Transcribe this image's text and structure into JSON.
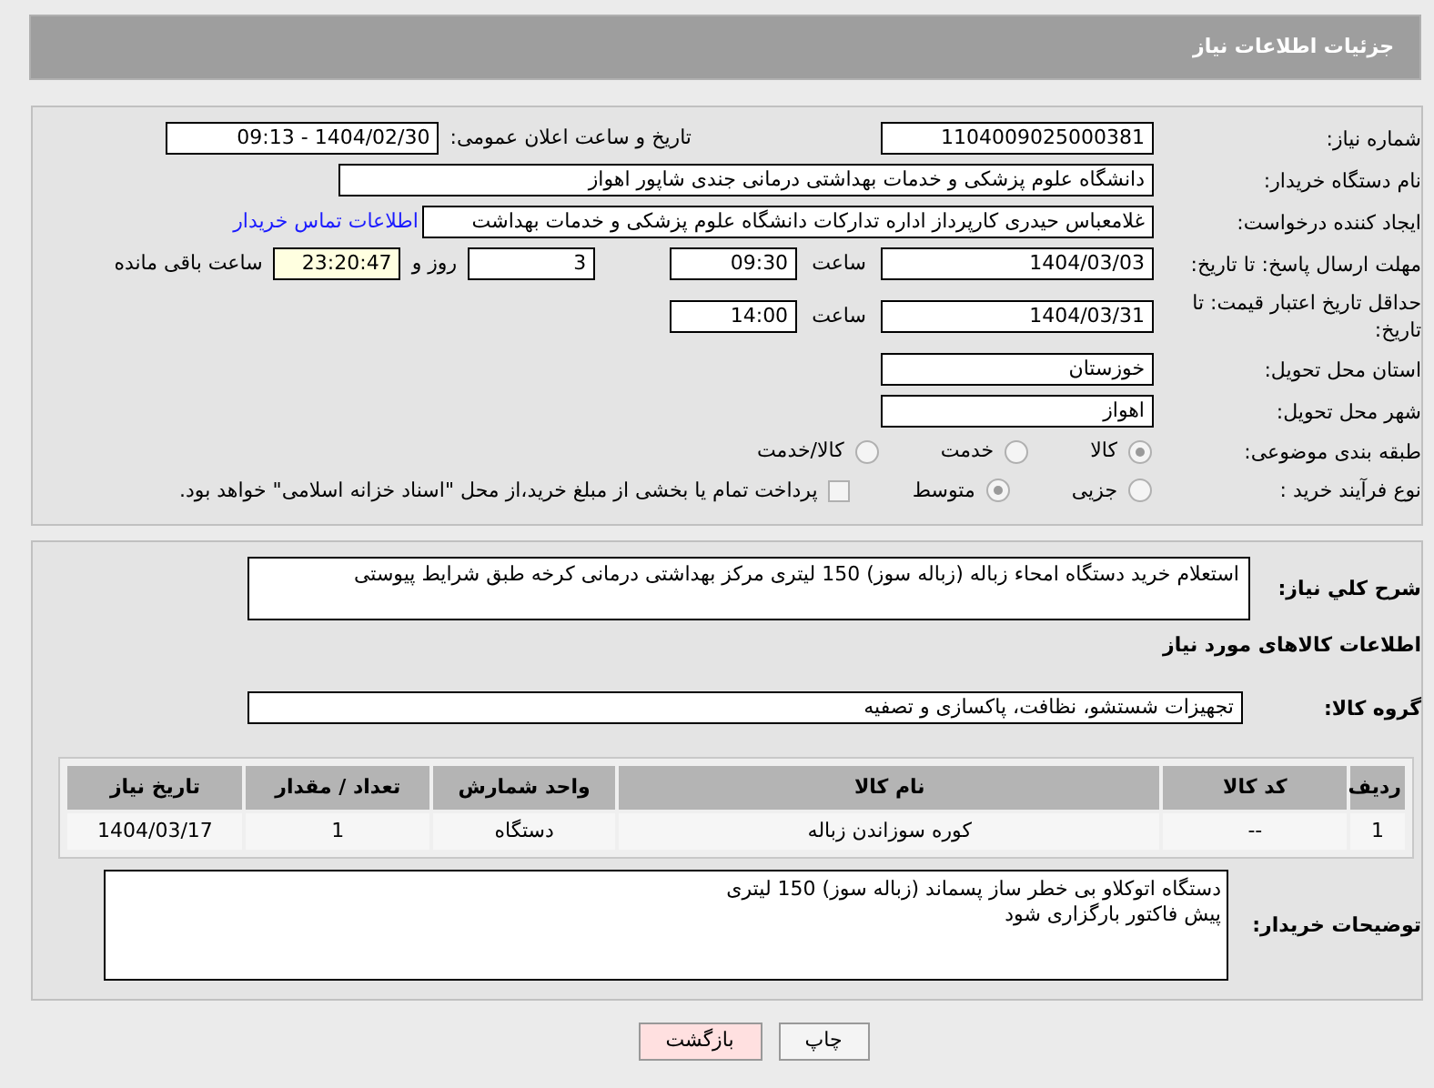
{
  "header": {
    "title": "جزئیات اطلاعات نیاز"
  },
  "need_number": {
    "label": "شماره نیاز:",
    "value": "1104009025000381"
  },
  "announce": {
    "label": "تاریخ و ساعت اعلان عمومی:",
    "value": "1404/02/30 - 09:13"
  },
  "buyer_org": {
    "label": "نام دستگاه خریدار:",
    "value": "دانشگاه علوم پزشکی و خدمات بهداشتی درمانی جندی شاپور اهواز"
  },
  "creator": {
    "label": "ایجاد کننده درخواست:",
    "value": "غلامعباس حیدری کارپرداز اداره تدارکات دانشگاه علوم پزشکی و خدمات بهداشت",
    "link": "اطلاعات تماس خریدار"
  },
  "deadline": {
    "label": "مهلت ارسال پاسخ: تا تاریخ:",
    "date": "1404/03/03",
    "time_label": "ساعت",
    "time": "09:30",
    "days": "3",
    "days_label": "روز و",
    "remaining": "23:20:47",
    "remaining_label": "ساعت باقی مانده"
  },
  "price_validity": {
    "label": "حداقل تاریخ اعتبار قیمت: تا تاریخ:",
    "date": "1404/03/31",
    "time_label": "ساعت",
    "time": "14:00"
  },
  "province": {
    "label": "استان محل تحویل:",
    "value": "خوزستان"
  },
  "city": {
    "label": "شهر محل تحویل:",
    "value": "اهواز"
  },
  "category": {
    "label": "طبقه بندی موضوعی:",
    "options": [
      {
        "label": "کالا",
        "selected": true
      },
      {
        "label": "خدمت",
        "selected": false
      },
      {
        "label": "کالا/خدمت",
        "selected": false
      }
    ]
  },
  "purchase_type": {
    "label": "نوع فرآیند خرید :",
    "options": [
      {
        "label": "جزیی",
        "selected": false
      },
      {
        "label": "متوسط",
        "selected": true
      }
    ],
    "payment": {
      "label": "پرداخت تمام یا بخشی از مبلغ خرید،از محل \"اسناد خزانه اسلامی\" خواهد بود.",
      "checked": false
    }
  },
  "description": {
    "label": "شرح کلي نياز:",
    "value": "استعلام خرید دستگاه امحاء زباله (زباله سوز) 150 لیتری مرکز بهداشتی درمانی کرخه طبق شرایط پیوستی"
  },
  "items_title": "اطلاعات کالاهای مورد نیاز",
  "goods_group": {
    "label": "گروه کالا:",
    "value": "تجهیزات شستشو، نظافت، پاکسازی و تصفیه"
  },
  "table": {
    "columns": [
      "ردیف",
      "کد کالا",
      "نام کالا",
      "واحد شمارش",
      "تعداد / مقدار",
      "تاریخ نیاز"
    ],
    "rows": [
      [
        "1",
        "--",
        "کوره سوزاندن زباله",
        "دستگاه",
        "1",
        "1404/03/17"
      ]
    ]
  },
  "buyer_notes": {
    "label": "توضیحات خریدار:",
    "lines": [
      "دستگاه اتوکلاو بی خطر ساز پسماند (زباله سوز) 150 لیتری",
      "پیش فاکتور بارگزاری شود"
    ]
  },
  "buttons": [
    {
      "label": "چاپ",
      "kind": "print"
    },
    {
      "label": "بازگشت",
      "kind": "back"
    }
  ]
}
